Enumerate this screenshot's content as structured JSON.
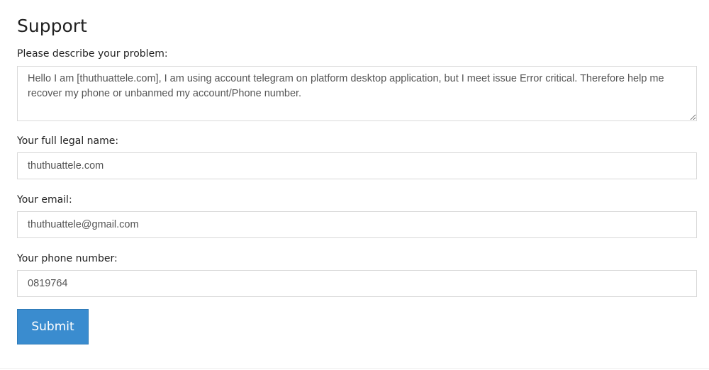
{
  "page": {
    "title": "Support"
  },
  "form": {
    "problem": {
      "label": "Please describe your problem:",
      "value": "Hello I am [thuthuattele.com], I am using account telegram on platform desktop application, but I meet issue Error critical. Therefore help me recover my phone or unbanmed my account/Phone number."
    },
    "full_name": {
      "label": "Your full legal name:",
      "value": "thuthuattele.com"
    },
    "email": {
      "label": "Your email:",
      "value": "thuthuattele@gmail.com"
    },
    "phone": {
      "label": "Your phone number:",
      "value": "0819764"
    },
    "submit_label": "Submit"
  },
  "colors": {
    "submit_background": "#3a8ccf",
    "border": "#d9d9d9"
  }
}
